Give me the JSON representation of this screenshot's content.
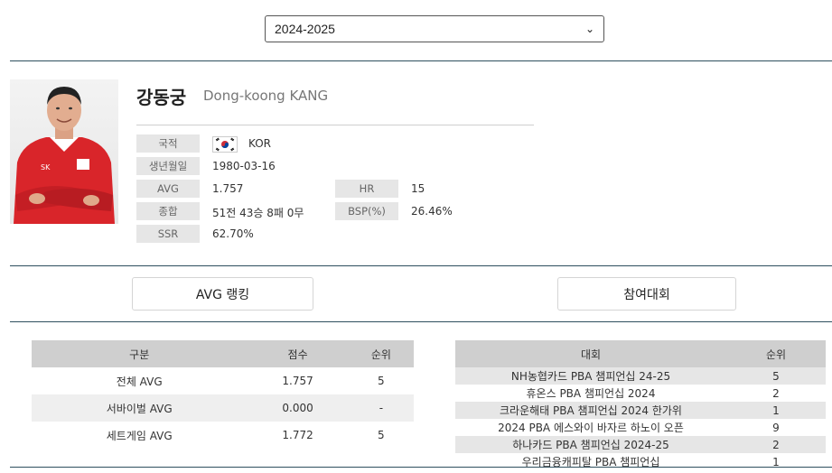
{
  "season_select": {
    "value": "2024-2025"
  },
  "player": {
    "name_ko": "강동궁",
    "name_en": "Dong-koong KANG",
    "info": {
      "nationality_label": "국적",
      "nationality_value": "KOR",
      "birth_label": "생년월일",
      "birth_value": "1980-03-16",
      "avg_label": "AVG",
      "avg_value": "1.757",
      "hr_label": "HR",
      "hr_value": "15",
      "total_label": "종합",
      "total_value": "51전 43승 8패 0무",
      "bsp_label": "BSP(%)",
      "bsp_value": "26.46%",
      "ssr_label": "SSR",
      "ssr_value": "62.70%"
    }
  },
  "tabs": {
    "avg_ranking": "AVG 랭킹",
    "tournaments": "참여대회"
  },
  "avg_table": {
    "headers": [
      "구분",
      "점수",
      "순위"
    ],
    "rows": [
      [
        "전체 AVG",
        "1.757",
        "5"
      ],
      [
        "서바이벌 AVG",
        "0.000",
        "-"
      ],
      [
        "세트게임 AVG",
        "1.772",
        "5"
      ]
    ]
  },
  "tournament_table": {
    "headers": [
      "대회",
      "순위"
    ],
    "rows": [
      [
        "NH농협카드 PBA 챔피언십 24-25",
        "5"
      ],
      [
        "휴온스 PBA 챔피언십 2024",
        "2"
      ],
      [
        "크라운해태 PBA 챔피언십 2024 한가위",
        "1"
      ],
      [
        "2024 PBA 에스와이 바자르 하노이 오픈",
        "9"
      ],
      [
        "하나카드 PBA 챔피언십 2024-25",
        "2"
      ],
      [
        "우리금융캐피탈 PBA 챔피언십",
        "1"
      ]
    ]
  },
  "colors": {
    "divider": "#2e4f5e",
    "label_bg": "#e6e6e6",
    "header_bg": "#cfcfcf",
    "jersey_red": "#d9252a"
  },
  "icons": {
    "flag": "korea-flag-icon",
    "select_arrow": "chevron-down-icon"
  }
}
